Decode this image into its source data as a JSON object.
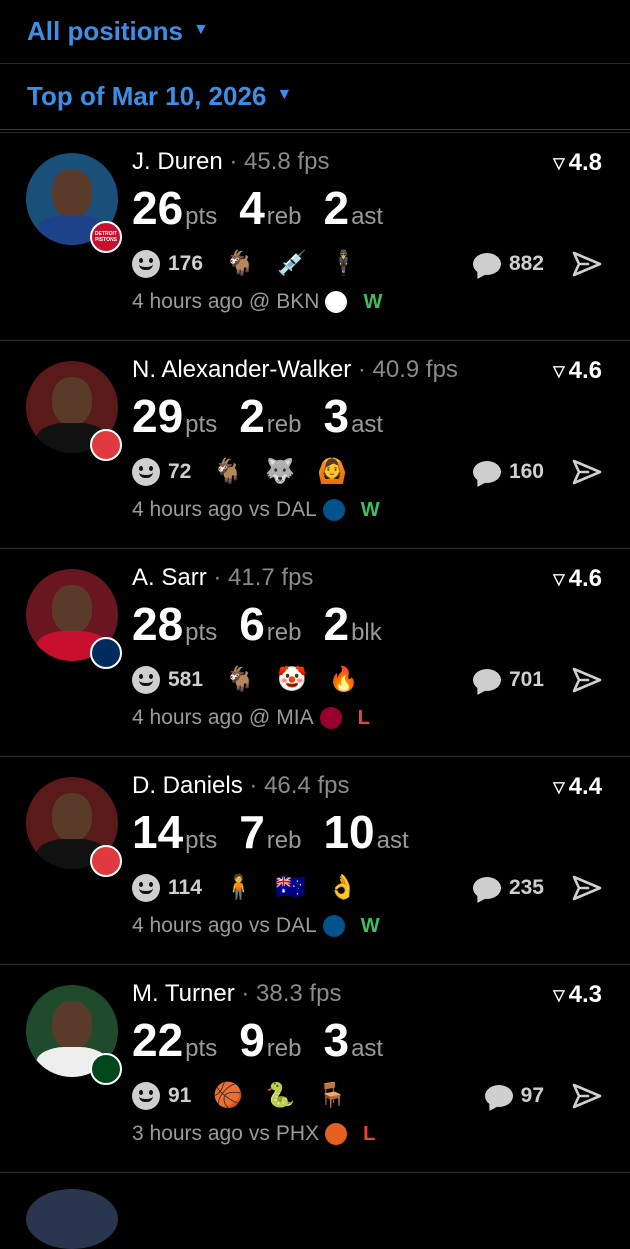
{
  "filters": {
    "position_label": "All positions",
    "date_label": "Top of Mar 10, 2026"
  },
  "icons": {
    "caret": "caret-down-icon",
    "rating": "triangle-icon",
    "reaction": "smile-icon",
    "comment": "comment-bubble-icon",
    "share": "send-arrow-icon"
  },
  "colors": {
    "accent": "#3d8ee6",
    "win": "#3fbf5a",
    "loss": "#e8453c"
  },
  "separator": "·",
  "cards": [
    {
      "name": "J. Duren",
      "fps": "45.8 fps",
      "rating": "4.8",
      "stats": [
        {
          "value": "26",
          "label": "pts"
        },
        {
          "value": "4",
          "label": "reb"
        },
        {
          "value": "2",
          "label": "ast"
        }
      ],
      "reaction_count": "176",
      "emojis": [
        "🐐",
        "💉",
        "🕴"
      ],
      "comment_count": "882",
      "time": "4 hours ago",
      "venue": "@",
      "opponent": "BKN",
      "result": "W",
      "team_badge_text": "DETROIT PISTONS",
      "team_color": "#c8102e",
      "opp_color": "#ffffff",
      "jersey_color": "#1d428a",
      "bg_color": "#1a4f7a"
    },
    {
      "name": "N. Alexander-Walker",
      "fps": "40.9 fps",
      "rating": "4.6",
      "stats": [
        {
          "value": "29",
          "label": "pts"
        },
        {
          "value": "2",
          "label": "reb"
        },
        {
          "value": "3",
          "label": "ast"
        }
      ],
      "reaction_count": "72",
      "emojis": [
        "🐐",
        "🐺",
        "🙆"
      ],
      "comment_count": "160",
      "time": "4 hours ago",
      "venue": "vs",
      "opponent": "DAL",
      "result": "W",
      "team_badge_text": "",
      "team_color": "#e03a3e",
      "opp_color": "#00538c",
      "jersey_color": "#111111",
      "bg_color": "#5a1a1a"
    },
    {
      "name": "A. Sarr",
      "fps": "41.7 fps",
      "rating": "4.6",
      "stats": [
        {
          "value": "28",
          "label": "pts"
        },
        {
          "value": "6",
          "label": "reb"
        },
        {
          "value": "2",
          "label": "blk"
        }
      ],
      "reaction_count": "581",
      "emojis": [
        "🐐",
        "🤡",
        "🔥"
      ],
      "comment_count": "701",
      "time": "4 hours ago",
      "venue": "@",
      "opponent": "MIA",
      "result": "L",
      "team_badge_text": "",
      "team_color": "#002b5c",
      "opp_color": "#98002e",
      "jersey_color": "#c8102e",
      "bg_color": "#6a1620"
    },
    {
      "name": "D. Daniels",
      "fps": "46.4 fps",
      "rating": "4.4",
      "stats": [
        {
          "value": "14",
          "label": "pts"
        },
        {
          "value": "7",
          "label": "reb"
        },
        {
          "value": "10",
          "label": "ast"
        }
      ],
      "reaction_count": "114",
      "emojis": [
        "🧍",
        "🇦🇺",
        "👌"
      ],
      "comment_count": "235",
      "time": "4 hours ago",
      "venue": "vs",
      "opponent": "DAL",
      "result": "W",
      "team_badge_text": "",
      "team_color": "#e03a3e",
      "opp_color": "#00538c",
      "jersey_color": "#111111",
      "bg_color": "#5a1a1a"
    },
    {
      "name": "M. Turner",
      "fps": "38.3 fps",
      "rating": "4.3",
      "stats": [
        {
          "value": "22",
          "label": "pts"
        },
        {
          "value": "9",
          "label": "reb"
        },
        {
          "value": "3",
          "label": "ast"
        }
      ],
      "reaction_count": "91",
      "emojis": [
        "🏀",
        "🐍",
        "🪑"
      ],
      "comment_count": "97",
      "time": "3 hours ago",
      "venue": "vs",
      "opponent": "PHX",
      "result": "L",
      "team_badge_text": "",
      "team_color": "#00471b",
      "opp_color": "#e56020",
      "jersey_color": "#eeeeee",
      "bg_color": "#1f4a2c"
    }
  ]
}
